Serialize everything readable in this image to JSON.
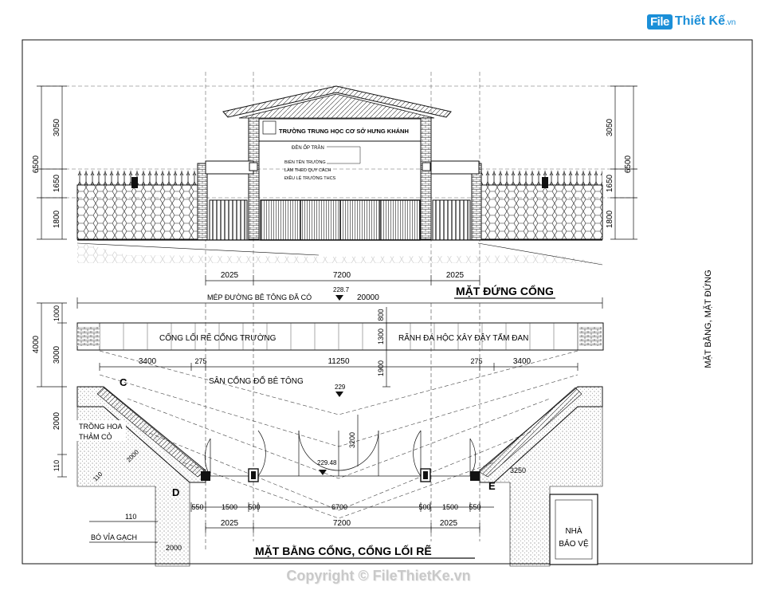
{
  "logo": {
    "badge": "File",
    "name": "Thiết Kế",
    "suffix": ".vn"
  },
  "copyright": "Copyright © FileThietKe.vn",
  "side_title": "MẶT BẰNG, MẶT ĐỨNG",
  "elevation": {
    "title": "MẶT ĐỨNG CỔNG",
    "left_dims": [
      "6500",
      "3050",
      "1650",
      "1800"
    ],
    "right_dims": [
      "3050",
      "6500",
      "1650",
      "1800"
    ],
    "bottom_dims": [
      "2025",
      "7200",
      "2025"
    ],
    "sign_school": "TRƯỜNG TRUNG HỌC CƠ SỞ HƯNG KHÁNH",
    "sign_note_1": "ĐÈN ỐP TRẦN",
    "sign_note_2": "BIỂN TÊN TRƯỜNG",
    "sign_note_3": "LÀM THEO QUY CÁCH",
    "sign_note_4": "ĐIỀU LỆ TRƯỜNG THCS"
  },
  "plan": {
    "title": "MẶT BẰNG CỔNG, CỔNG LỐI RẼ",
    "road": "MÉP ĐƯỜNG BÊ TÔNG ĐÃ CÓ",
    "level_top": "228.7",
    "width_total": "20000",
    "drain": "CỐNG LỐI RẼ CỔNG TRƯỜNG",
    "ditch": "RÃNH ĐÁ HỘC XÂY ĐẬY TẤM ĐAN",
    "dim_800": "800",
    "dim_1300": "1300",
    "dim_1900": "1900",
    "yard": "SÂN CỔNG ĐỔ BÊ TÔNG",
    "level_yard": "229",
    "level_gate": "229.48",
    "dims_row": [
      "3400",
      "275",
      "11250",
      "275",
      "3400"
    ],
    "left_dims": [
      "1000",
      "4000",
      "3000",
      "2000",
      "110"
    ],
    "dim_3200": "3200",
    "dim_2000": "2000",
    "dim_110": "110",
    "dim_3250": "3250",
    "label_c": "C",
    "label_d": "D",
    "label_e": "E",
    "flower": "TRỒNG HOA",
    "grass": "THẢM CỎ",
    "curb": "BÓ VỈA GẠCH",
    "curb_dim": "110",
    "dim_2000b": "2000",
    "gate_dims": [
      "550",
      "1500",
      "500",
      "6700",
      "500",
      "1500",
      "550"
    ],
    "bottom_dims": [
      "2025",
      "7200",
      "2025"
    ],
    "guard_1": "NHÀ",
    "guard_2": "BẢO VỆ"
  }
}
